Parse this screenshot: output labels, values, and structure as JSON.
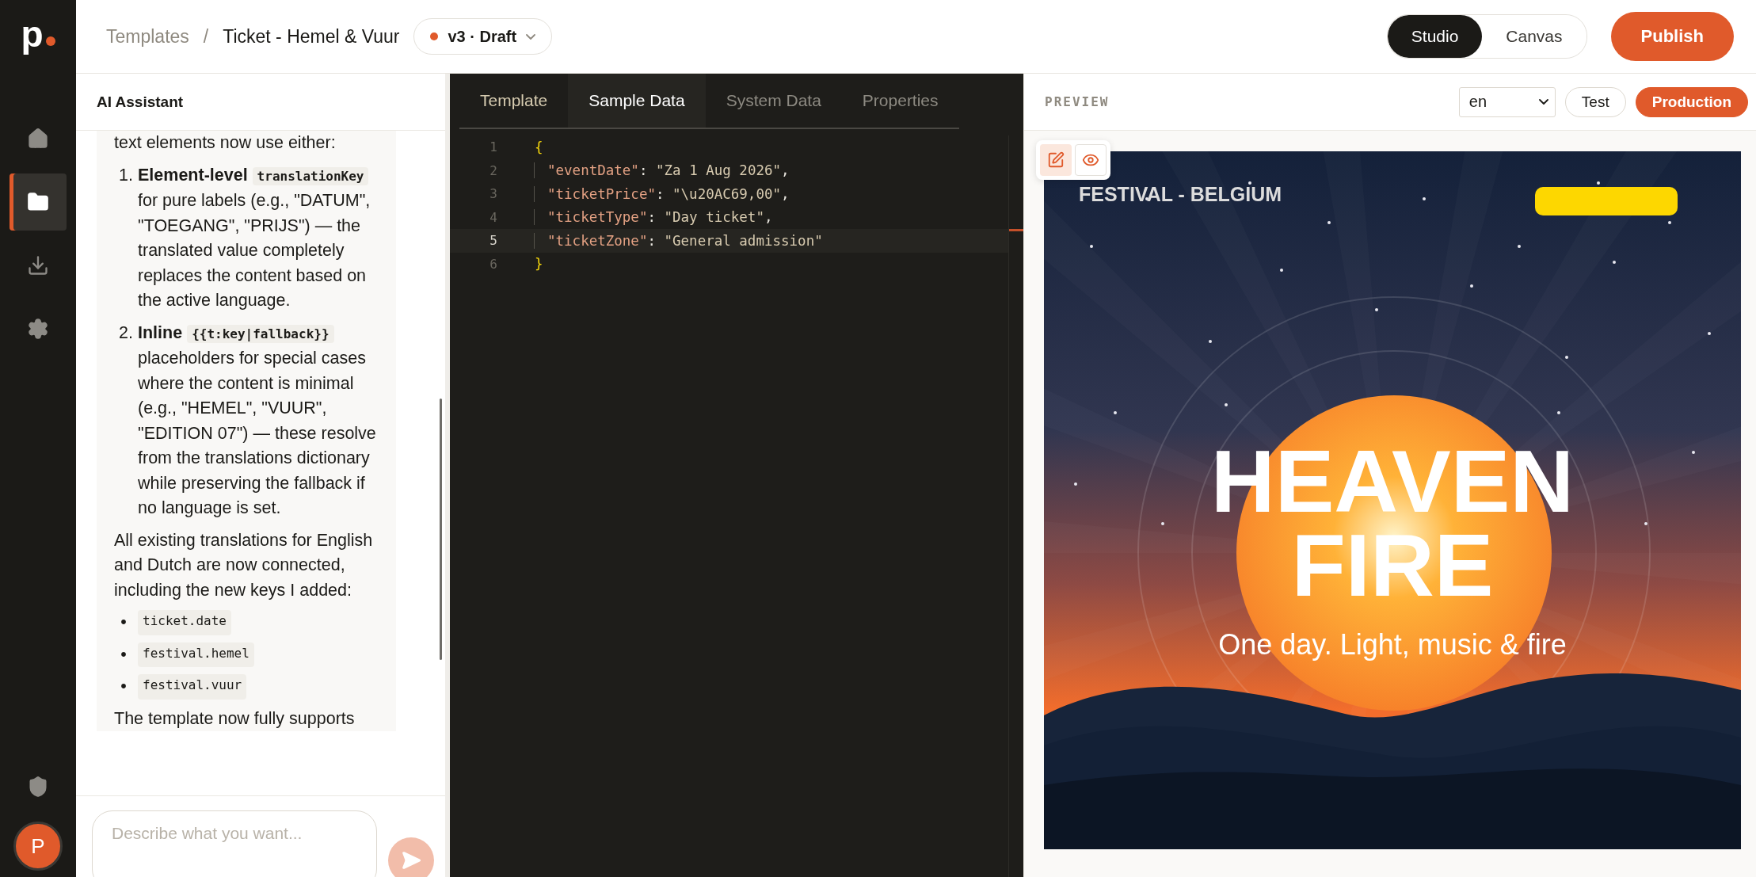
{
  "rail": {
    "logo": "p",
    "nav": [
      {
        "kind": "home",
        "selected": false
      },
      {
        "kind": "folder",
        "selected": true
      },
      {
        "kind": "download",
        "selected": false
      },
      {
        "kind": "settings",
        "selected": false
      }
    ],
    "avatar": "P"
  },
  "topbar": {
    "breadcrumb": [
      {
        "label": "Templates",
        "current": false
      },
      {
        "label": "Ticket - Hemel & Vuur",
        "current": true
      }
    ],
    "separator": "/",
    "version": "v3 · Draft",
    "modes": [
      {
        "label": "Studio",
        "selected": true
      },
      {
        "label": "Canvas",
        "selected": false
      }
    ],
    "publish": "Publish"
  },
  "assistant": {
    "title": "AI Assistant",
    "message": [
      {
        "kind": "paragraph",
        "parts": [
          {
            "kind": "text",
            "text": "text elements now use either:"
          }
        ]
      },
      {
        "kind": "numbered",
        "number": "1.",
        "parts": [
          {
            "kind": "bold",
            "text": "Element-level"
          },
          {
            "kind": "code",
            "text": "translationKey"
          },
          {
            "kind": "text",
            "text": "for pure labels (e.g., \"DATUM\", \"TOEGANG\", \"PRIJS\") — the translated value completely replaces the content based on the active language."
          }
        ]
      },
      {
        "kind": "numbered",
        "number": "2.",
        "parts": [
          {
            "kind": "bold",
            "text": "Inline"
          },
          {
            "kind": "code",
            "text": "{{t:key|fallback}}"
          },
          {
            "kind": "text",
            "text": "placeholders for special cases where the content is minimal (e.g., \"HEMEL\", \"VUUR\", \"EDITION 07\") — these resolve from the translations dictionary while preserving the fallback if no language is set."
          }
        ]
      },
      {
        "kind": "paragraph",
        "parts": [
          {
            "kind": "text",
            "text": "All existing translations for English and Dutch are now connected, including the new keys I added:"
          }
        ]
      },
      {
        "kind": "bullet",
        "bullet": "•",
        "code": "ticket.date"
      },
      {
        "kind": "bullet",
        "bullet": "•",
        "code": "festival.hemel"
      },
      {
        "kind": "bullet",
        "bullet": "•",
        "code": "festival.vuur"
      },
      {
        "kind": "paragraph",
        "parts": [
          {
            "kind": "text",
            "text": "The template now fully supports"
          }
        ]
      }
    ],
    "input": {
      "placeholder": "Describe what you want..."
    },
    "send": {
      "disabled": true
    }
  },
  "editor": {
    "tabs": [
      {
        "label": "Template",
        "selected": false
      },
      {
        "label": "Sample Data",
        "selected": true
      },
      {
        "label": "System Data",
        "selected": false
      },
      {
        "label": "Properties",
        "selected": false
      }
    ],
    "lines": [
      {
        "number": "1",
        "active": false,
        "tokens": [
          {
            "kind": "brace",
            "text": "{"
          }
        ]
      },
      {
        "number": "2",
        "active": false,
        "tokens": [
          {
            "kind": "key",
            "text": "\"eventDate\""
          },
          {
            "kind": "punct",
            "text": ": "
          },
          {
            "kind": "string",
            "text": "\"Za 1 Aug 2026\""
          },
          {
            "kind": "punct",
            "text": ","
          }
        ]
      },
      {
        "number": "3",
        "active": false,
        "tokens": [
          {
            "kind": "key",
            "text": "\"ticketPrice\""
          },
          {
            "kind": "punct",
            "text": ": "
          },
          {
            "kind": "string",
            "text": "\"\\u20AC69,00\""
          },
          {
            "kind": "punct",
            "text": ","
          }
        ]
      },
      {
        "number": "4",
        "active": false,
        "tokens": [
          {
            "kind": "key",
            "text": "\"ticketType\""
          },
          {
            "kind": "punct",
            "text": ": "
          },
          {
            "kind": "string",
            "text": "\"Day ticket\""
          },
          {
            "kind": "punct",
            "text": ","
          }
        ]
      },
      {
        "number": "5",
        "active": true,
        "tokens": [
          {
            "kind": "key",
            "text": "\"ticketZone\""
          },
          {
            "kind": "punct",
            "text": ": "
          },
          {
            "kind": "string",
            "text": "\"General admission\""
          }
        ]
      },
      {
        "number": "6",
        "active": false,
        "tokens": [
          {
            "kind": "brace",
            "text": "}"
          }
        ]
      }
    ]
  },
  "preview": {
    "label": "PREVIEW",
    "language": "en",
    "environments": [
      {
        "label": "Test",
        "selected": false
      },
      {
        "label": "Production",
        "selected": true
      }
    ],
    "tools": [
      {
        "kind": "edit",
        "selected": true
      },
      {
        "kind": "view",
        "selected": false
      }
    ],
    "ticket": {
      "eyebrow": "FESTIVAL - BELGIUM",
      "title_lines": [
        "HEAVEN",
        "FIRE"
      ],
      "tagline": "One day. Light, music & fire"
    }
  }
}
